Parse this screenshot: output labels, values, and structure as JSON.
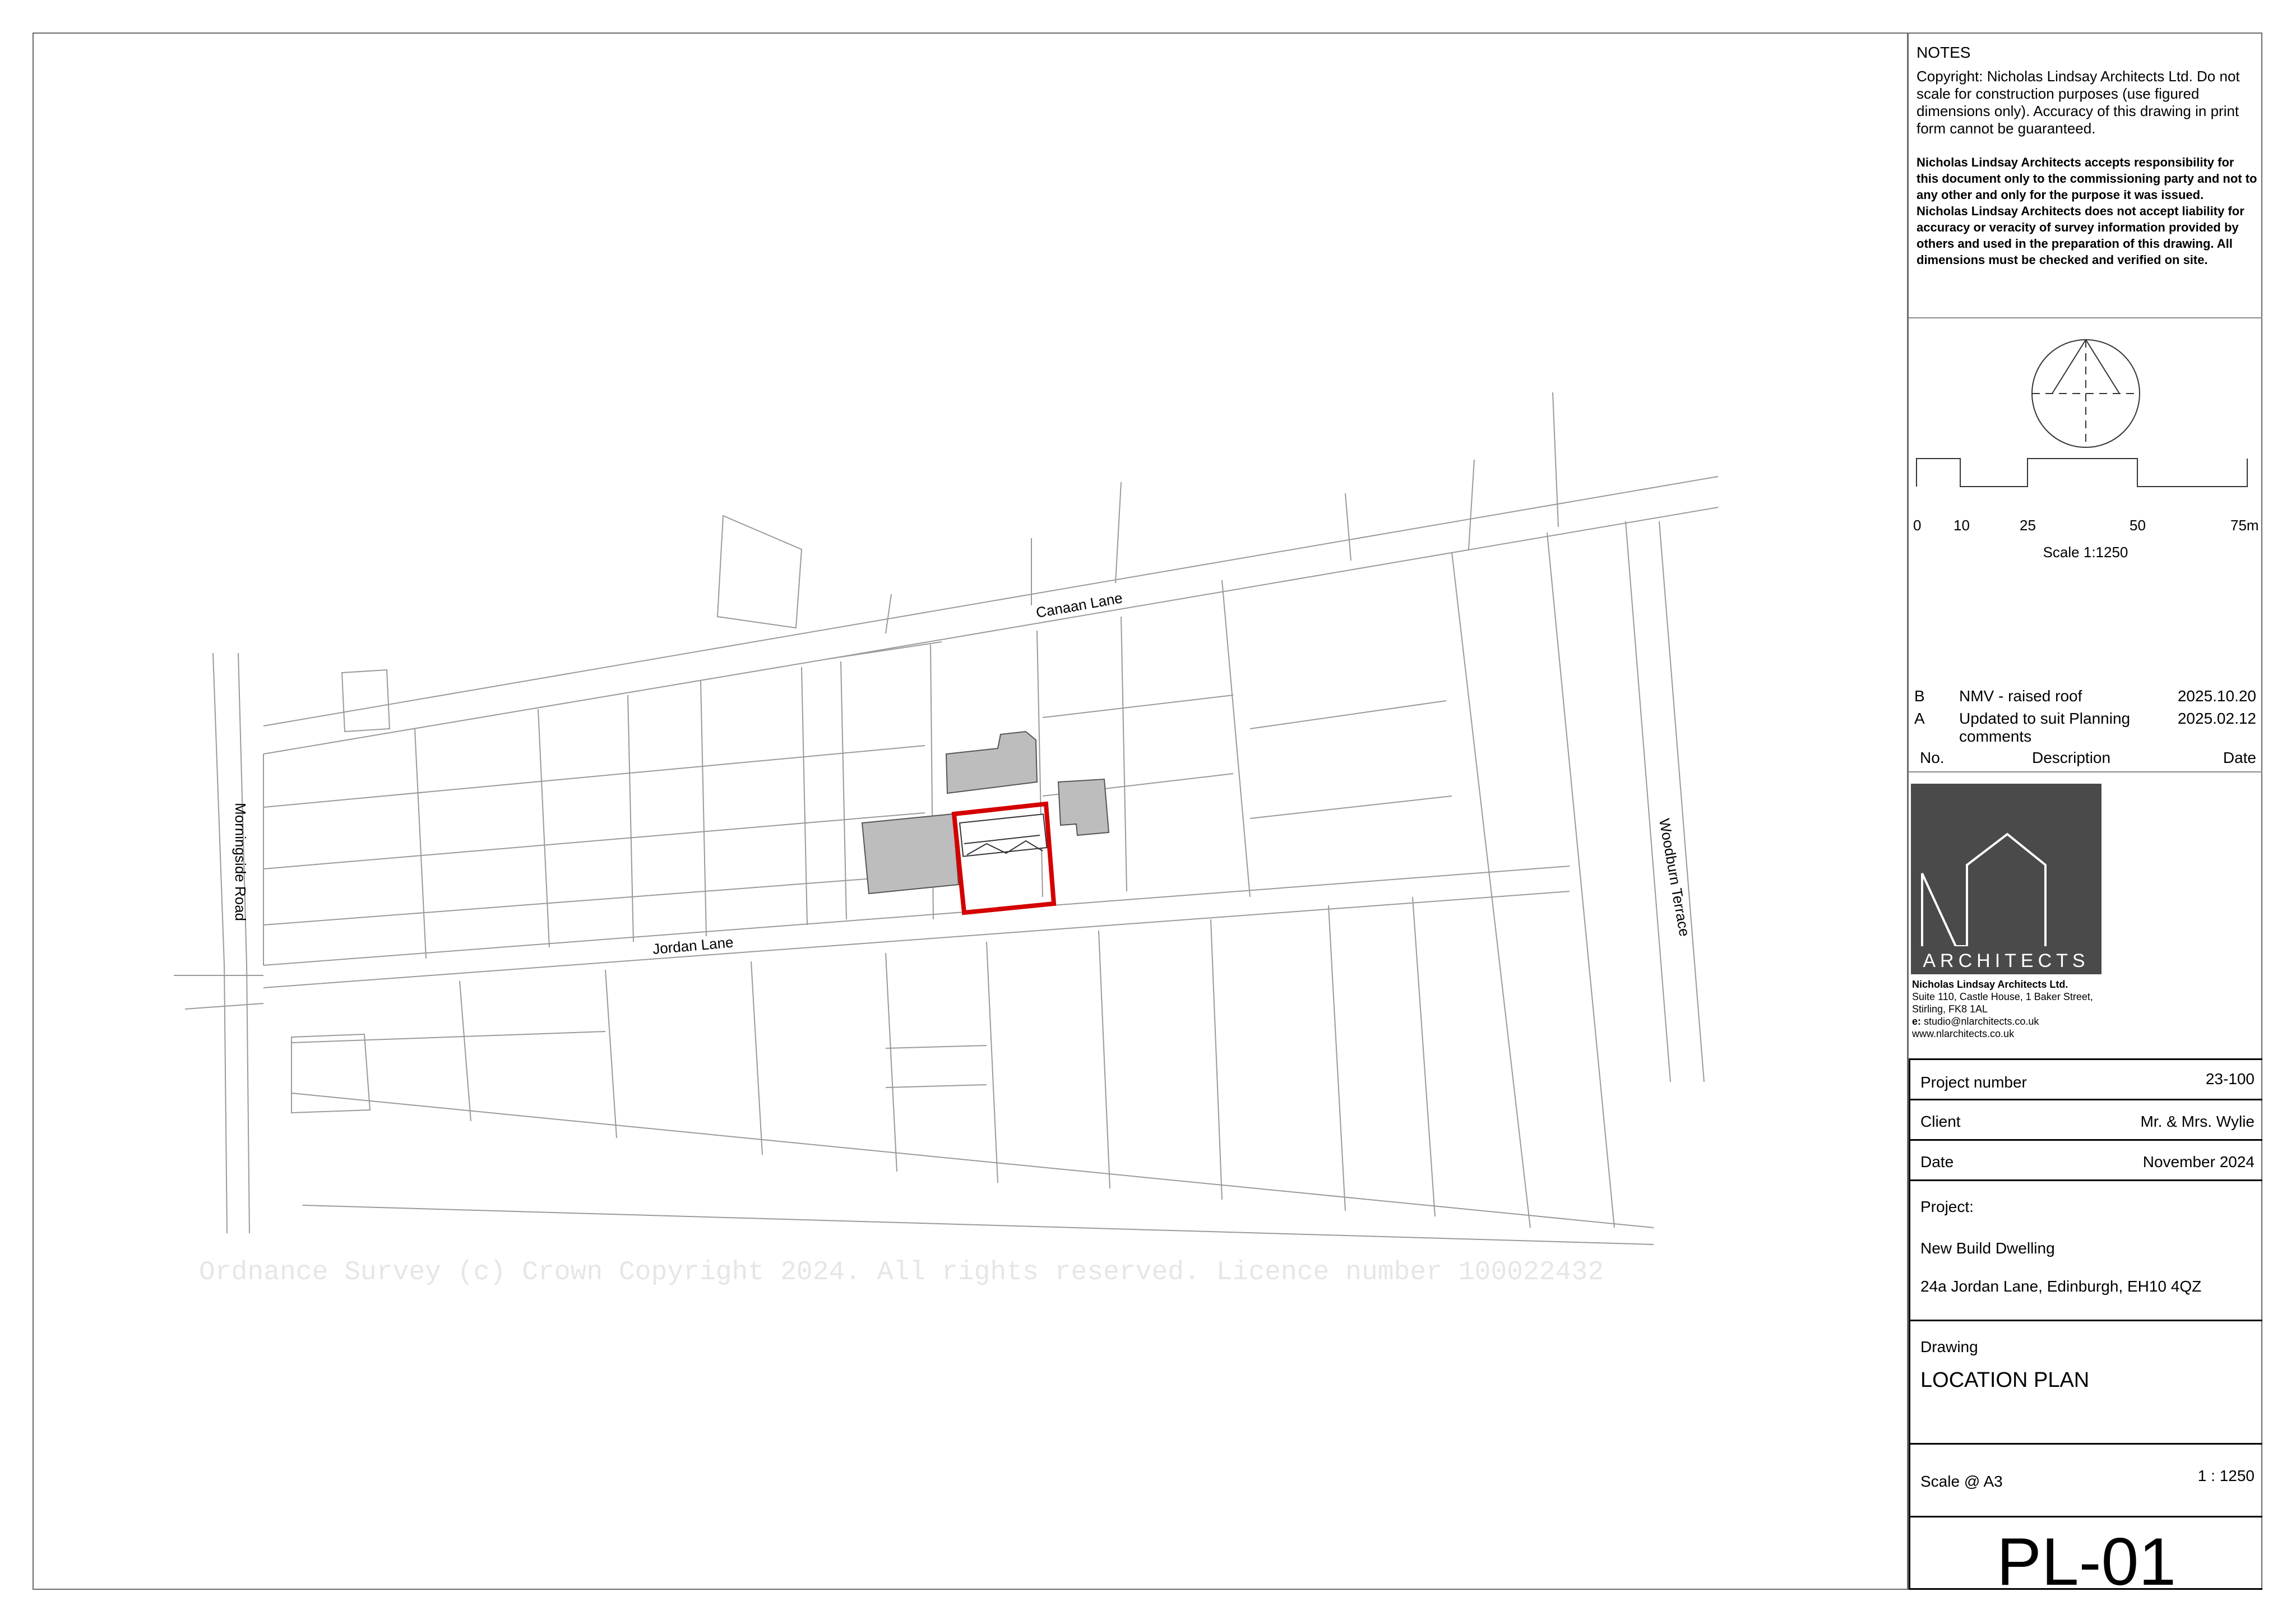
{
  "notes": {
    "heading": "NOTES",
    "copyright": "Copyright:  Nicholas Lindsay Architects Ltd. Do not scale for construction purposes (use figured dimensions only). Accuracy of this drawing in print form cannot be guaranteed.",
    "responsibility": "Nicholas Lindsay Architects accepts responsibility for this document only to the commissioning party and not to any other and only for the purpose it was issued.",
    "liability": "Nicholas Lindsay Architects does not accept liability for accuracy or veracity of survey information provided by others and used in the preparation of this drawing.  All dimensions must be checked and verified on site."
  },
  "scale_bar": {
    "labels": [
      "0",
      "10",
      "25",
      "50",
      "75m"
    ],
    "caption": "Scale 1:1250"
  },
  "revisions": {
    "rows": [
      {
        "no": "B",
        "description": "NMV - raised roof",
        "date": "2025.10.20"
      },
      {
        "no": "A",
        "description": "Updated to suit Planning comments",
        "date": "2025.02.12"
      }
    ],
    "headers": {
      "no": "No.",
      "description": "Description",
      "date": "Date"
    }
  },
  "logo": {
    "text": "ARCHITECTS"
  },
  "address": {
    "name": "Nicholas Lindsay Architects Ltd.",
    "line1": "Suite 110, Castle House, 1 Baker Street,",
    "line2": "Stirling, FK8 1AL",
    "email_label": "e:",
    "email": "studio@nlarchitects.co.uk",
    "web": "www.nlarchitects.co.uk"
  },
  "title_block": {
    "project_number_label": "Project number",
    "project_number": "23-100",
    "client_label": "Client",
    "client": "Mr. & Mrs. Wylie",
    "date_label": "Date",
    "date": "November 2024",
    "project_label": "Project:",
    "project_name": "New Build Dwelling",
    "project_address": "24a Jordan Lane, Edinburgh, EH10 4QZ",
    "drawing_label": "Drawing",
    "drawing_name": "LOCATION PLAN",
    "scale_label": "Scale @ A3",
    "scale": "1 : 1250",
    "drawing_number": "PL-01"
  },
  "map": {
    "streets": [
      "Canaan Lane",
      "Jordan Lane",
      "Morningside Road",
      "Woodburn Terrace"
    ],
    "copyright": "Ordnance Survey (c) Crown Copyright 2024. All rights reserved. Licence number 100022432",
    "site_boundary_color": "#d40000",
    "building_fill": "#bdbdbd"
  }
}
